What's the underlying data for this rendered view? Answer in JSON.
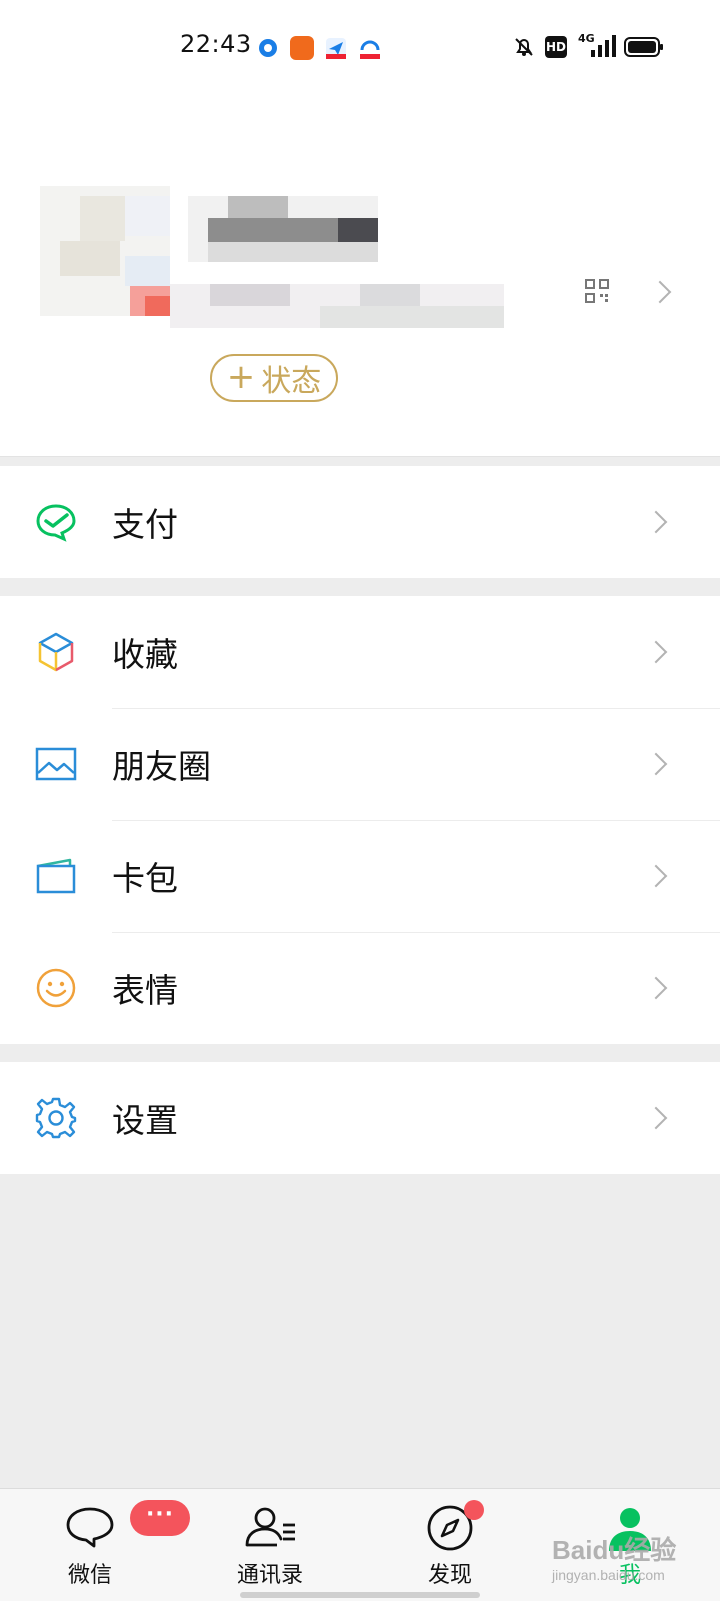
{
  "status_bar": {
    "time": "22:43",
    "hd_label": "HD",
    "network_label": "4G"
  },
  "profile": {
    "status_button": {
      "plus": "+",
      "label": "状态"
    },
    "qr_icon": "qr-code-icon",
    "chevron_icon": "chevron-right-icon"
  },
  "menu": {
    "pay": {
      "label": "支付",
      "icon": "wechat-pay-icon",
      "color": "#07c160"
    },
    "favorites": {
      "label": "收藏",
      "icon": "favorites-cube-icon"
    },
    "moments": {
      "label": "朋友圈",
      "icon": "moments-image-icon",
      "color": "#2a8dd8"
    },
    "cards": {
      "label": "卡包",
      "icon": "card-wallet-icon",
      "color": "#2a8dd8"
    },
    "stickers": {
      "label": "表情",
      "icon": "smiley-icon",
      "color": "#f0a13a"
    },
    "settings": {
      "label": "设置",
      "icon": "gear-icon",
      "color": "#2a8dd8"
    }
  },
  "bottom_nav": {
    "items": [
      {
        "label": "微信",
        "icon": "chat-bubble-icon",
        "badge": "···"
      },
      {
        "label": "通讯录",
        "icon": "contacts-icon"
      },
      {
        "label": "发现",
        "icon": "compass-icon"
      },
      {
        "label": "我",
        "icon": "person-icon",
        "active": true,
        "color": "#07c160"
      }
    ]
  },
  "watermark": {
    "line1": "Baidu经验",
    "line2": "jingyan.baidu.com"
  }
}
